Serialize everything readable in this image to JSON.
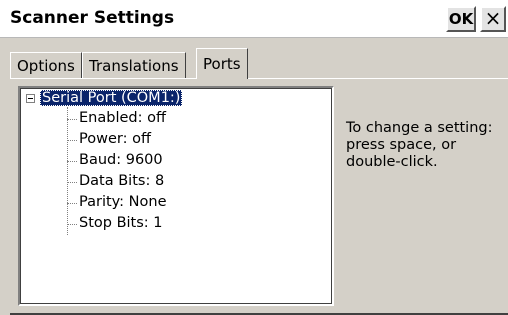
{
  "window": {
    "title": "Scanner Settings",
    "ok_label": "OK",
    "close_label": "×"
  },
  "tabs": [
    {
      "label": "Options",
      "active": false
    },
    {
      "label": "Translations",
      "active": false
    },
    {
      "label": "Ports",
      "active": true
    }
  ],
  "tree": {
    "root_label": "Serial Port (COM1:)",
    "root_expanded": true,
    "children": [
      "Enabled: off",
      "Power: off",
      "Baud: 9600",
      "Data Bits: 8",
      "Parity: None",
      "Stop Bits: 1"
    ]
  },
  "help_text": "To change a setting: press space, or double-click.",
  "colors": {
    "selection_bg": "#0a246a",
    "dialog_bg": "#d4d0c8"
  }
}
